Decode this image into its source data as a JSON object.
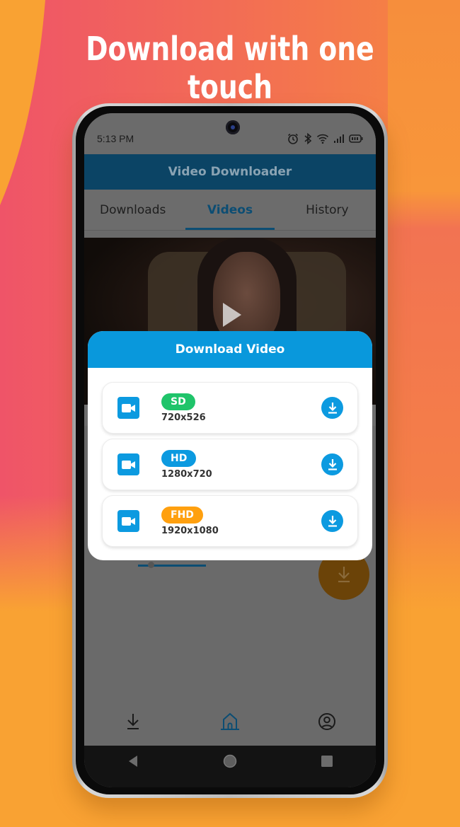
{
  "promo": {
    "headline": "Download with one touch"
  },
  "status_bar": {
    "time": "5:13 PM",
    "icons": [
      "alarm-icon",
      "bluetooth-icon",
      "wifi-icon",
      "signal-icon",
      "battery-icon"
    ]
  },
  "app": {
    "title": "Video Downloader",
    "tabs": [
      {
        "label": "Downloads",
        "active": false
      },
      {
        "label": "Videos",
        "active": true
      },
      {
        "label": "History",
        "active": false
      }
    ],
    "accent_color": "#0998dc"
  },
  "dialog": {
    "title": "Download Video",
    "options": [
      {
        "quality": "SD",
        "resolution": "720x526",
        "badge_color": "#1fc46a"
      },
      {
        "quality": "HD",
        "resolution": "1280x720",
        "badge_color": "#0c9ae0"
      },
      {
        "quality": "FHD",
        "resolution": "1920x1080",
        "badge_color": "#ffa00f"
      }
    ]
  },
  "bottom_nav": {
    "items": [
      {
        "icon": "download-icon",
        "active": false
      },
      {
        "icon": "home-icon",
        "active": true
      },
      {
        "icon": "profile-icon",
        "active": false
      }
    ]
  },
  "system_nav": {
    "items": [
      "back-icon",
      "home-circle-icon",
      "recents-icon"
    ]
  }
}
